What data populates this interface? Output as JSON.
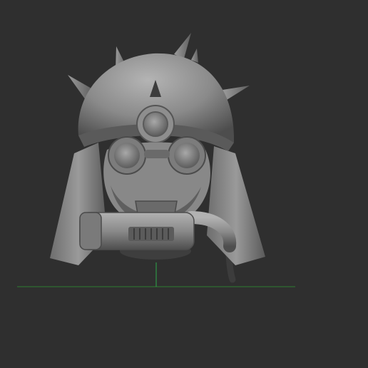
{
  "viewport": {
    "background": "#2f2f2f",
    "model_name_icon": "sculpted-helmet-model",
    "grid": {
      "floor_axis_color": "#2e7d32",
      "up_axis_color": "#2ea84a"
    },
    "material_color": "#8c8c8c"
  }
}
